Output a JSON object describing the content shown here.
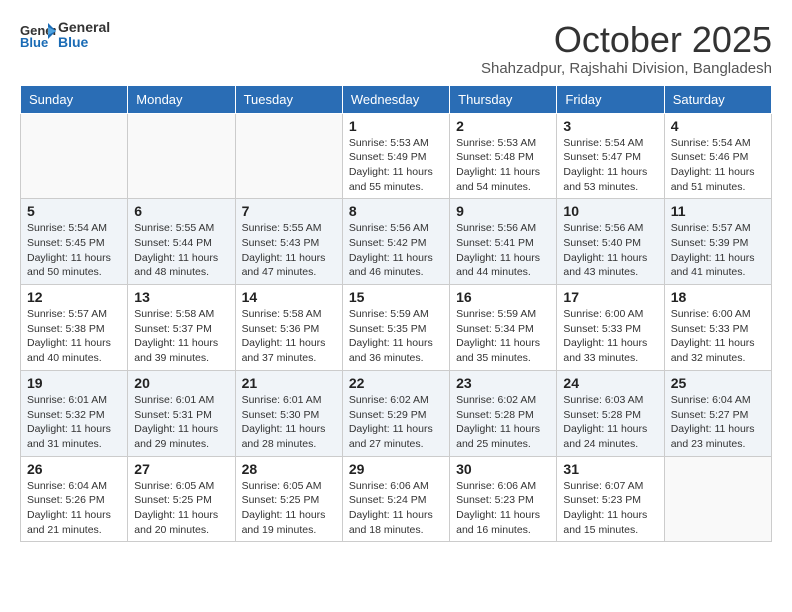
{
  "logo": {
    "general": "General",
    "blue": "Blue"
  },
  "title": "October 2025",
  "location": "Shahzadpur, Rajshahi Division, Bangladesh",
  "days": [
    "Sunday",
    "Monday",
    "Tuesday",
    "Wednesday",
    "Thursday",
    "Friday",
    "Saturday"
  ],
  "weeks": [
    [
      {
        "day": "",
        "info": ""
      },
      {
        "day": "",
        "info": ""
      },
      {
        "day": "",
        "info": ""
      },
      {
        "day": "1",
        "info": "Sunrise: 5:53 AM\nSunset: 5:49 PM\nDaylight: 11 hours\nand 55 minutes."
      },
      {
        "day": "2",
        "info": "Sunrise: 5:53 AM\nSunset: 5:48 PM\nDaylight: 11 hours\nand 54 minutes."
      },
      {
        "day": "3",
        "info": "Sunrise: 5:54 AM\nSunset: 5:47 PM\nDaylight: 11 hours\nand 53 minutes."
      },
      {
        "day": "4",
        "info": "Sunrise: 5:54 AM\nSunset: 5:46 PM\nDaylight: 11 hours\nand 51 minutes."
      }
    ],
    [
      {
        "day": "5",
        "info": "Sunrise: 5:54 AM\nSunset: 5:45 PM\nDaylight: 11 hours\nand 50 minutes."
      },
      {
        "day": "6",
        "info": "Sunrise: 5:55 AM\nSunset: 5:44 PM\nDaylight: 11 hours\nand 48 minutes."
      },
      {
        "day": "7",
        "info": "Sunrise: 5:55 AM\nSunset: 5:43 PM\nDaylight: 11 hours\nand 47 minutes."
      },
      {
        "day": "8",
        "info": "Sunrise: 5:56 AM\nSunset: 5:42 PM\nDaylight: 11 hours\nand 46 minutes."
      },
      {
        "day": "9",
        "info": "Sunrise: 5:56 AM\nSunset: 5:41 PM\nDaylight: 11 hours\nand 44 minutes."
      },
      {
        "day": "10",
        "info": "Sunrise: 5:56 AM\nSunset: 5:40 PM\nDaylight: 11 hours\nand 43 minutes."
      },
      {
        "day": "11",
        "info": "Sunrise: 5:57 AM\nSunset: 5:39 PM\nDaylight: 11 hours\nand 41 minutes."
      }
    ],
    [
      {
        "day": "12",
        "info": "Sunrise: 5:57 AM\nSunset: 5:38 PM\nDaylight: 11 hours\nand 40 minutes."
      },
      {
        "day": "13",
        "info": "Sunrise: 5:58 AM\nSunset: 5:37 PM\nDaylight: 11 hours\nand 39 minutes."
      },
      {
        "day": "14",
        "info": "Sunrise: 5:58 AM\nSunset: 5:36 PM\nDaylight: 11 hours\nand 37 minutes."
      },
      {
        "day": "15",
        "info": "Sunrise: 5:59 AM\nSunset: 5:35 PM\nDaylight: 11 hours\nand 36 minutes."
      },
      {
        "day": "16",
        "info": "Sunrise: 5:59 AM\nSunset: 5:34 PM\nDaylight: 11 hours\nand 35 minutes."
      },
      {
        "day": "17",
        "info": "Sunrise: 6:00 AM\nSunset: 5:33 PM\nDaylight: 11 hours\nand 33 minutes."
      },
      {
        "day": "18",
        "info": "Sunrise: 6:00 AM\nSunset: 5:33 PM\nDaylight: 11 hours\nand 32 minutes."
      }
    ],
    [
      {
        "day": "19",
        "info": "Sunrise: 6:01 AM\nSunset: 5:32 PM\nDaylight: 11 hours\nand 31 minutes."
      },
      {
        "day": "20",
        "info": "Sunrise: 6:01 AM\nSunset: 5:31 PM\nDaylight: 11 hours\nand 29 minutes."
      },
      {
        "day": "21",
        "info": "Sunrise: 6:01 AM\nSunset: 5:30 PM\nDaylight: 11 hours\nand 28 minutes."
      },
      {
        "day": "22",
        "info": "Sunrise: 6:02 AM\nSunset: 5:29 PM\nDaylight: 11 hours\nand 27 minutes."
      },
      {
        "day": "23",
        "info": "Sunrise: 6:02 AM\nSunset: 5:28 PM\nDaylight: 11 hours\nand 25 minutes."
      },
      {
        "day": "24",
        "info": "Sunrise: 6:03 AM\nSunset: 5:28 PM\nDaylight: 11 hours\nand 24 minutes."
      },
      {
        "day": "25",
        "info": "Sunrise: 6:04 AM\nSunset: 5:27 PM\nDaylight: 11 hours\nand 23 minutes."
      }
    ],
    [
      {
        "day": "26",
        "info": "Sunrise: 6:04 AM\nSunset: 5:26 PM\nDaylight: 11 hours\nand 21 minutes."
      },
      {
        "day": "27",
        "info": "Sunrise: 6:05 AM\nSunset: 5:25 PM\nDaylight: 11 hours\nand 20 minutes."
      },
      {
        "day": "28",
        "info": "Sunrise: 6:05 AM\nSunset: 5:25 PM\nDaylight: 11 hours\nand 19 minutes."
      },
      {
        "day": "29",
        "info": "Sunrise: 6:06 AM\nSunset: 5:24 PM\nDaylight: 11 hours\nand 18 minutes."
      },
      {
        "day": "30",
        "info": "Sunrise: 6:06 AM\nSunset: 5:23 PM\nDaylight: 11 hours\nand 16 minutes."
      },
      {
        "day": "31",
        "info": "Sunrise: 6:07 AM\nSunset: 5:23 PM\nDaylight: 11 hours\nand 15 minutes."
      },
      {
        "day": "",
        "info": ""
      }
    ]
  ]
}
